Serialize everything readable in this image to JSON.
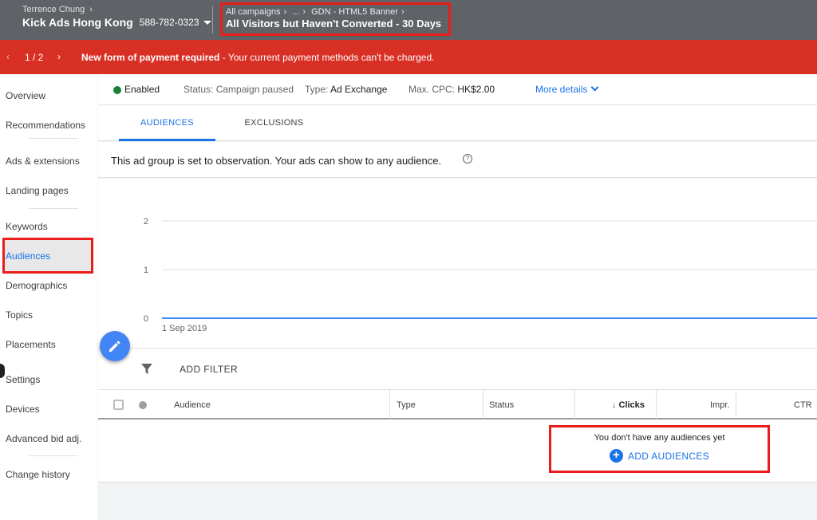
{
  "header": {
    "owner": "Terrence Chung",
    "account_name": "Kick Ads Hong Kong",
    "customer_id": "588-782-0323",
    "breadcrumb_root": "All campaigns",
    "breadcrumb_ellipsis": "...",
    "breadcrumb_campaign": "GDN - HTML5 Banner",
    "current_view": "All Visitors but Haven't Converted - 30 Days"
  },
  "alert": {
    "page_indicator": "1 / 2",
    "title": "New form of payment required",
    "message": " - Your current payment methods can't be charged."
  },
  "sidebar": {
    "items": [
      {
        "label": "Overview"
      },
      {
        "label": "Recommendations"
      },
      {
        "label": "Ads & extensions"
      },
      {
        "label": "Landing pages"
      },
      {
        "label": "Keywords"
      },
      {
        "label": "Audiences"
      },
      {
        "label": "Demographics"
      },
      {
        "label": "Topics"
      },
      {
        "label": "Placements"
      },
      {
        "label": "Settings"
      },
      {
        "label": "Devices"
      },
      {
        "label": "Advanced bid adj."
      },
      {
        "label": "Change history"
      }
    ],
    "active": "Audiences"
  },
  "status_bar": {
    "state": "Enabled",
    "status_label": "Status:",
    "status_value": "Campaign paused",
    "type_label": "Type:",
    "type_value": "Ad Exchange",
    "cpc_label": "Max. CPC:",
    "cpc_value": "HK$2.00",
    "more_details": "More details"
  },
  "tabs": [
    {
      "label": "AUDIENCES",
      "active": true
    },
    {
      "label": "EXCLUSIONS",
      "active": false
    }
  ],
  "observation_note": "This ad group is set to observation. Your ads can show to any audience.",
  "chart_data": {
    "type": "line",
    "x": [
      "1 Sep 2019"
    ],
    "y_ticks": [
      "2",
      "1",
      "0"
    ],
    "ylim": [
      0,
      2
    ],
    "series": [
      {
        "values": [
          0
        ]
      }
    ],
    "color": "#4285f4"
  },
  "filter": {
    "label": "ADD FILTER"
  },
  "table": {
    "columns": [
      "Audience",
      "Type",
      "Status",
      "Clicks",
      "Impr.",
      "CTR"
    ],
    "sorted_column": "Clicks",
    "empty_message": "You don't have any audiences yet",
    "add_button": "ADD AUDIENCES"
  },
  "icons": {
    "filter": "filter-icon",
    "edit": "pencil-icon",
    "help": "help-circle-icon",
    "sort": "arrow-down-icon"
  },
  "colors": {
    "accent": "#1a73e8",
    "alert_bg": "#d93025",
    "enabled_dot": "#188038",
    "highlight": "#ea1c1c"
  }
}
